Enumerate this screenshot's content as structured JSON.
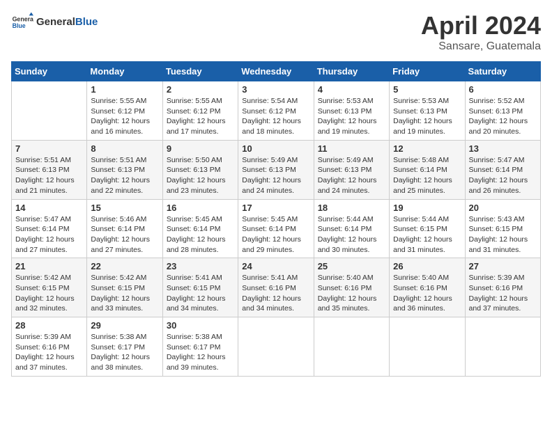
{
  "header": {
    "logo_general": "General",
    "logo_blue": "Blue",
    "month": "April 2024",
    "location": "Sansare, Guatemala"
  },
  "weekdays": [
    "Sunday",
    "Monday",
    "Tuesday",
    "Wednesday",
    "Thursday",
    "Friday",
    "Saturday"
  ],
  "weeks": [
    [
      {
        "day": "",
        "sunrise": "",
        "sunset": "",
        "daylight": ""
      },
      {
        "day": "1",
        "sunrise": "Sunrise: 5:55 AM",
        "sunset": "Sunset: 6:12 PM",
        "daylight": "Daylight: 12 hours and 16 minutes."
      },
      {
        "day": "2",
        "sunrise": "Sunrise: 5:55 AM",
        "sunset": "Sunset: 6:12 PM",
        "daylight": "Daylight: 12 hours and 17 minutes."
      },
      {
        "day": "3",
        "sunrise": "Sunrise: 5:54 AM",
        "sunset": "Sunset: 6:12 PM",
        "daylight": "Daylight: 12 hours and 18 minutes."
      },
      {
        "day": "4",
        "sunrise": "Sunrise: 5:53 AM",
        "sunset": "Sunset: 6:13 PM",
        "daylight": "Daylight: 12 hours and 19 minutes."
      },
      {
        "day": "5",
        "sunrise": "Sunrise: 5:53 AM",
        "sunset": "Sunset: 6:13 PM",
        "daylight": "Daylight: 12 hours and 19 minutes."
      },
      {
        "day": "6",
        "sunrise": "Sunrise: 5:52 AM",
        "sunset": "Sunset: 6:13 PM",
        "daylight": "Daylight: 12 hours and 20 minutes."
      }
    ],
    [
      {
        "day": "7",
        "sunrise": "Sunrise: 5:51 AM",
        "sunset": "Sunset: 6:13 PM",
        "daylight": "Daylight: 12 hours and 21 minutes."
      },
      {
        "day": "8",
        "sunrise": "Sunrise: 5:51 AM",
        "sunset": "Sunset: 6:13 PM",
        "daylight": "Daylight: 12 hours and 22 minutes."
      },
      {
        "day": "9",
        "sunrise": "Sunrise: 5:50 AM",
        "sunset": "Sunset: 6:13 PM",
        "daylight": "Daylight: 12 hours and 23 minutes."
      },
      {
        "day": "10",
        "sunrise": "Sunrise: 5:49 AM",
        "sunset": "Sunset: 6:13 PM",
        "daylight": "Daylight: 12 hours and 24 minutes."
      },
      {
        "day": "11",
        "sunrise": "Sunrise: 5:49 AM",
        "sunset": "Sunset: 6:13 PM",
        "daylight": "Daylight: 12 hours and 24 minutes."
      },
      {
        "day": "12",
        "sunrise": "Sunrise: 5:48 AM",
        "sunset": "Sunset: 6:14 PM",
        "daylight": "Daylight: 12 hours and 25 minutes."
      },
      {
        "day": "13",
        "sunrise": "Sunrise: 5:47 AM",
        "sunset": "Sunset: 6:14 PM",
        "daylight": "Daylight: 12 hours and 26 minutes."
      }
    ],
    [
      {
        "day": "14",
        "sunrise": "Sunrise: 5:47 AM",
        "sunset": "Sunset: 6:14 PM",
        "daylight": "Daylight: 12 hours and 27 minutes."
      },
      {
        "day": "15",
        "sunrise": "Sunrise: 5:46 AM",
        "sunset": "Sunset: 6:14 PM",
        "daylight": "Daylight: 12 hours and 27 minutes."
      },
      {
        "day": "16",
        "sunrise": "Sunrise: 5:45 AM",
        "sunset": "Sunset: 6:14 PM",
        "daylight": "Daylight: 12 hours and 28 minutes."
      },
      {
        "day": "17",
        "sunrise": "Sunrise: 5:45 AM",
        "sunset": "Sunset: 6:14 PM",
        "daylight": "Daylight: 12 hours and 29 minutes."
      },
      {
        "day": "18",
        "sunrise": "Sunrise: 5:44 AM",
        "sunset": "Sunset: 6:14 PM",
        "daylight": "Daylight: 12 hours and 30 minutes."
      },
      {
        "day": "19",
        "sunrise": "Sunrise: 5:44 AM",
        "sunset": "Sunset: 6:15 PM",
        "daylight": "Daylight: 12 hours and 31 minutes."
      },
      {
        "day": "20",
        "sunrise": "Sunrise: 5:43 AM",
        "sunset": "Sunset: 6:15 PM",
        "daylight": "Daylight: 12 hours and 31 minutes."
      }
    ],
    [
      {
        "day": "21",
        "sunrise": "Sunrise: 5:42 AM",
        "sunset": "Sunset: 6:15 PM",
        "daylight": "Daylight: 12 hours and 32 minutes."
      },
      {
        "day": "22",
        "sunrise": "Sunrise: 5:42 AM",
        "sunset": "Sunset: 6:15 PM",
        "daylight": "Daylight: 12 hours and 33 minutes."
      },
      {
        "day": "23",
        "sunrise": "Sunrise: 5:41 AM",
        "sunset": "Sunset: 6:15 PM",
        "daylight": "Daylight: 12 hours and 34 minutes."
      },
      {
        "day": "24",
        "sunrise": "Sunrise: 5:41 AM",
        "sunset": "Sunset: 6:16 PM",
        "daylight": "Daylight: 12 hours and 34 minutes."
      },
      {
        "day": "25",
        "sunrise": "Sunrise: 5:40 AM",
        "sunset": "Sunset: 6:16 PM",
        "daylight": "Daylight: 12 hours and 35 minutes."
      },
      {
        "day": "26",
        "sunrise": "Sunrise: 5:40 AM",
        "sunset": "Sunset: 6:16 PM",
        "daylight": "Daylight: 12 hours and 36 minutes."
      },
      {
        "day": "27",
        "sunrise": "Sunrise: 5:39 AM",
        "sunset": "Sunset: 6:16 PM",
        "daylight": "Daylight: 12 hours and 37 minutes."
      }
    ],
    [
      {
        "day": "28",
        "sunrise": "Sunrise: 5:39 AM",
        "sunset": "Sunset: 6:16 PM",
        "daylight": "Daylight: 12 hours and 37 minutes."
      },
      {
        "day": "29",
        "sunrise": "Sunrise: 5:38 AM",
        "sunset": "Sunset: 6:17 PM",
        "daylight": "Daylight: 12 hours and 38 minutes."
      },
      {
        "day": "30",
        "sunrise": "Sunrise: 5:38 AM",
        "sunset": "Sunset: 6:17 PM",
        "daylight": "Daylight: 12 hours and 39 minutes."
      },
      {
        "day": "",
        "sunrise": "",
        "sunset": "",
        "daylight": ""
      },
      {
        "day": "",
        "sunrise": "",
        "sunset": "",
        "daylight": ""
      },
      {
        "day": "",
        "sunrise": "",
        "sunset": "",
        "daylight": ""
      },
      {
        "day": "",
        "sunrise": "",
        "sunset": "",
        "daylight": ""
      }
    ]
  ]
}
